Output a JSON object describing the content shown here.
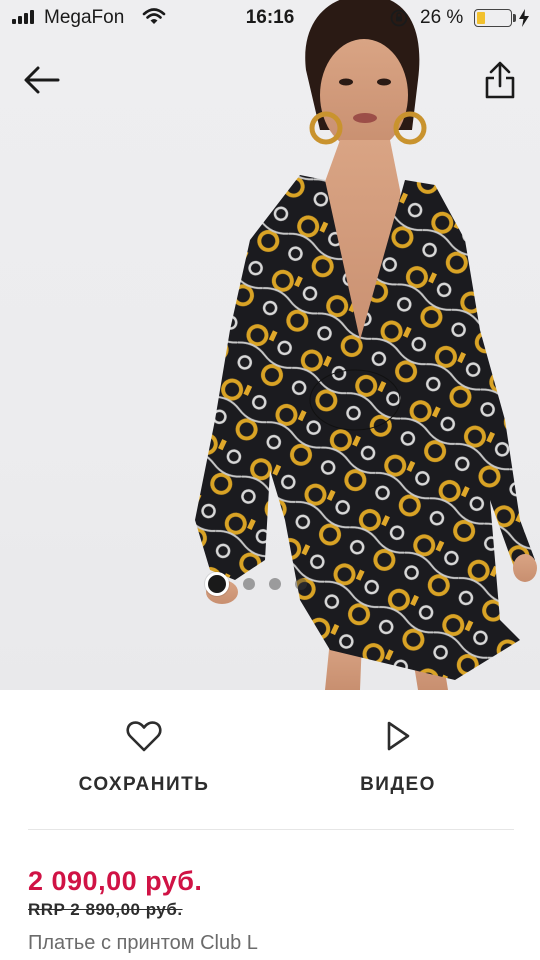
{
  "status_bar": {
    "carrier": "MegaFon",
    "time": "16:16",
    "battery_percent": "26 %",
    "battery_level": 0.26,
    "icons": [
      "signal-icon",
      "wifi-icon",
      "rotation-lock-icon",
      "battery-icon",
      "charging-icon"
    ]
  },
  "nav": {
    "back_icon": "arrow-left-icon",
    "share_icon": "share-icon"
  },
  "gallery": {
    "image": "product-photo",
    "dots": [
      true,
      false,
      false,
      false
    ],
    "active_index": 0
  },
  "actions": {
    "save_label": "СОХРАНИТЬ",
    "save_icon": "heart-icon",
    "video_label": "ВИДЕО",
    "video_icon": "play-icon"
  },
  "product": {
    "price": "2 090,00 руб.",
    "rrp": "RRP 2 890,00 руб.",
    "title": "Платье с принтом Club L"
  },
  "colors": {
    "price": "#d01345",
    "text": "#2d2d2d",
    "muted": "#6b6b6b",
    "battery": "#f2c12e"
  }
}
